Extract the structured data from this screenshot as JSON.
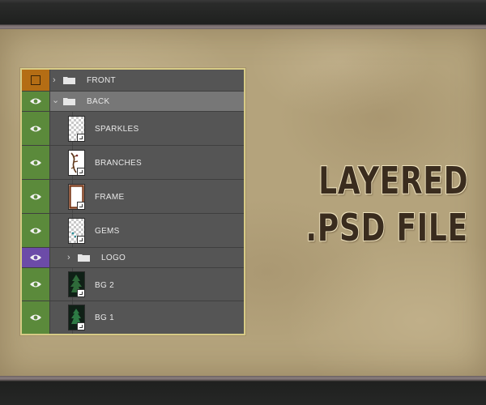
{
  "layers_panel": {
    "rows": [
      {
        "name": "FRONT",
        "kind": "group",
        "expanded": false,
        "visibility": "hidden",
        "vis_color": "#b46d14"
      },
      {
        "name": "BACK",
        "kind": "group",
        "expanded": true,
        "visibility": "visible",
        "selected": true,
        "vis_color": "#5b8a3b"
      },
      {
        "name": "SPARKLES",
        "kind": "smart-object",
        "thumbnail": "transparent",
        "visibility": "visible"
      },
      {
        "name": "BRANCHES",
        "kind": "smart-object",
        "thumbnail": "branches-art",
        "visibility": "visible"
      },
      {
        "name": "FRAME",
        "kind": "smart-object",
        "thumbnail": "frame-art",
        "visibility": "visible"
      },
      {
        "name": "GEMS",
        "kind": "smart-object",
        "thumbnail": "transparent",
        "visibility": "visible"
      },
      {
        "name": "LOGO",
        "kind": "group",
        "expanded": false,
        "visibility": "visible",
        "vis_color": "#6c4ba8"
      },
      {
        "name": "BG 2",
        "kind": "smart-object",
        "thumbnail": "dark-forest",
        "visibility": "visible"
      },
      {
        "name": "BG 1",
        "kind": "smart-object",
        "thumbnail": "dark-forest",
        "visibility": "visible"
      }
    ],
    "visible_icon": "eye-icon",
    "folder_icon": "folder-icon",
    "smart_object_badge": "smart-object-badge-icon"
  },
  "headline": {
    "line1": "LAYERED",
    "line2": ".PSD FILE",
    "color": "#3a2c1e"
  },
  "colors": {
    "background": "#b4a37c",
    "panel": "#555555",
    "panel_border": "#d7cb86",
    "visible_green": "#5b8a3b"
  }
}
